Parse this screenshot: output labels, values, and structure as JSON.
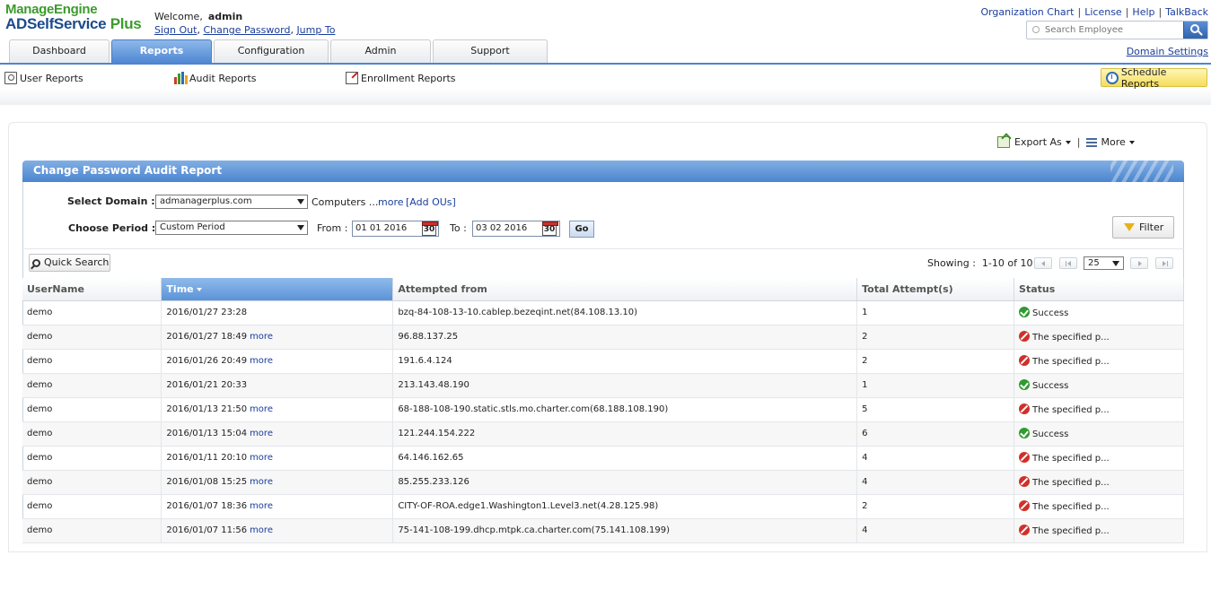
{
  "header": {
    "brand_line1": "ManageEngine",
    "brand_line2": "ADSelfService",
    "brand_plus": "Plus",
    "welcome_label": "Welcome,",
    "username": "admin",
    "sign_out": "Sign Out",
    "change_password": "Change Password",
    "jump_to": "Jump To",
    "top_links": [
      "Organization Chart",
      "License",
      "Help",
      "TalkBack"
    ],
    "search_placeholder": "Search Employee",
    "domain_settings": "Domain Settings"
  },
  "tabs": [
    {
      "label": "Dashboard",
      "active": false
    },
    {
      "label": "Reports",
      "active": true
    },
    {
      "label": "Configuration",
      "active": false
    },
    {
      "label": "Admin",
      "active": false
    },
    {
      "label": "Support",
      "active": false
    }
  ],
  "subnav": {
    "user_reports": "User Reports",
    "audit_reports": "Audit Reports",
    "enrollment_reports": "Enrollment Reports",
    "schedule_reports": "Schedule Reports"
  },
  "actions": {
    "export_as": "Export As",
    "more": "More"
  },
  "report": {
    "title": "Change Password Audit Report",
    "select_domain_label": "Select Domain :",
    "domain_value": "admanagerplus.com",
    "computers_text": "Computers ...",
    "more_link": "more",
    "add_ous": "[Add OUs]",
    "choose_period_label": "Choose Period :",
    "period_value": "Custom Period",
    "from_label": "From :",
    "from_date": "01 01 2016",
    "to_label": "To :",
    "to_date": "03 02 2016",
    "calendar_day": "30",
    "go": "Go",
    "filter": "Filter",
    "quick_search": "Quick Search",
    "showing_label": "Showing :",
    "showing_range": "1-10 of 10",
    "per_page": "25"
  },
  "table": {
    "columns": [
      "UserName",
      "Time",
      "Attempted from",
      "Total Attempt(s)",
      "Status"
    ],
    "sorted_column": "Time",
    "rows": [
      {
        "user": "demo",
        "time": "2016/01/27 23:28",
        "more": "",
        "from": "bzq-84-108-13-10.cablep.bezeqint.net(84.108.13.10)",
        "attempts": "1",
        "status": "Success",
        "ok": true
      },
      {
        "user": "demo",
        "time": "2016/01/27 18:49",
        "more": "more",
        "from": "96.88.137.25",
        "attempts": "2",
        "status": "The specified p...",
        "ok": false
      },
      {
        "user": "demo",
        "time": "2016/01/26 20:49",
        "more": "more",
        "from": "191.6.4.124",
        "attempts": "2",
        "status": "The specified p...",
        "ok": false
      },
      {
        "user": "demo",
        "time": "2016/01/21 20:33",
        "more": "",
        "from": "213.143.48.190",
        "attempts": "1",
        "status": "Success",
        "ok": true
      },
      {
        "user": "demo",
        "time": "2016/01/13 21:50",
        "more": "more",
        "from": "68-188-108-190.static.stls.mo.charter.com(68.188.108.190)",
        "attempts": "5",
        "status": "The specified p...",
        "ok": false
      },
      {
        "user": "demo",
        "time": "2016/01/13 15:04",
        "more": "more",
        "from": "121.244.154.222",
        "attempts": "6",
        "status": "Success",
        "ok": true
      },
      {
        "user": "demo",
        "time": "2016/01/11 20:10",
        "more": "more",
        "from": "64.146.162.65",
        "attempts": "4",
        "status": "The specified p...",
        "ok": false
      },
      {
        "user": "demo",
        "time": "2016/01/08 15:25",
        "more": "more",
        "from": "85.255.233.126",
        "attempts": "4",
        "status": "The specified p...",
        "ok": false
      },
      {
        "user": "demo",
        "time": "2016/01/07 18:36",
        "more": "more",
        "from": "CITY-OF-ROA.edge1.Washington1.Level3.net(4.28.125.98)",
        "attempts": "2",
        "status": "The specified p...",
        "ok": false
      },
      {
        "user": "demo",
        "time": "2016/01/07 11:56",
        "more": "more",
        "from": "75-141-108-199.dhcp.mtpk.ca.charter.com(75.141.108.199)",
        "attempts": "4",
        "status": "The specified p...",
        "ok": false
      }
    ]
  }
}
